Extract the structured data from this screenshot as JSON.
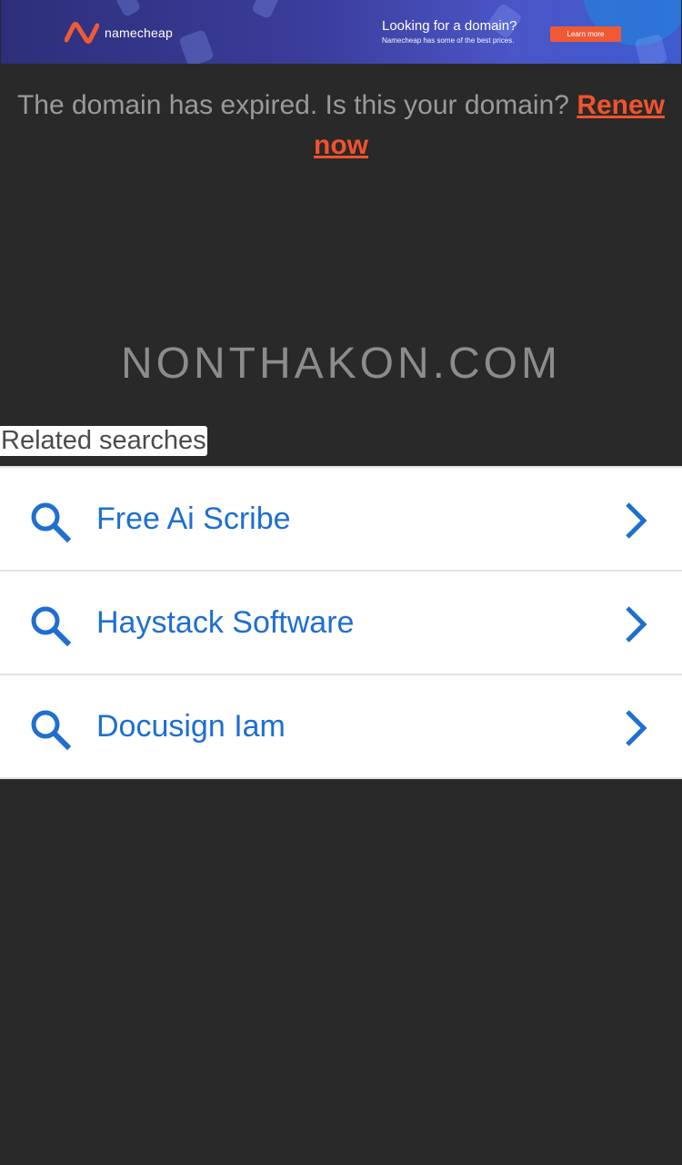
{
  "ad": {
    "brand": "namecheap",
    "title": "Looking for a domain?",
    "subtitle": "Namecheap has some of the best prices.",
    "button_label": "Learn more",
    "brand_color": "#ef5a35"
  },
  "notice": {
    "message": "The domain has expired. Is this your domain?",
    "renew_link": "Renew now",
    "link_color": "#f0532d"
  },
  "domain_name": "NONTHAKON.COM",
  "related": {
    "label": "Related searches",
    "items": [
      {
        "label": "Free Ai Scribe",
        "icon": "search-icon",
        "arrow": "chevron-right-icon"
      },
      {
        "label": "Haystack Software",
        "icon": "search-icon",
        "arrow": "chevron-right-icon"
      },
      {
        "label": "Docusign Iam",
        "icon": "search-icon",
        "arrow": "chevron-right-icon"
      }
    ],
    "accent_color": "#1e6fd0"
  }
}
